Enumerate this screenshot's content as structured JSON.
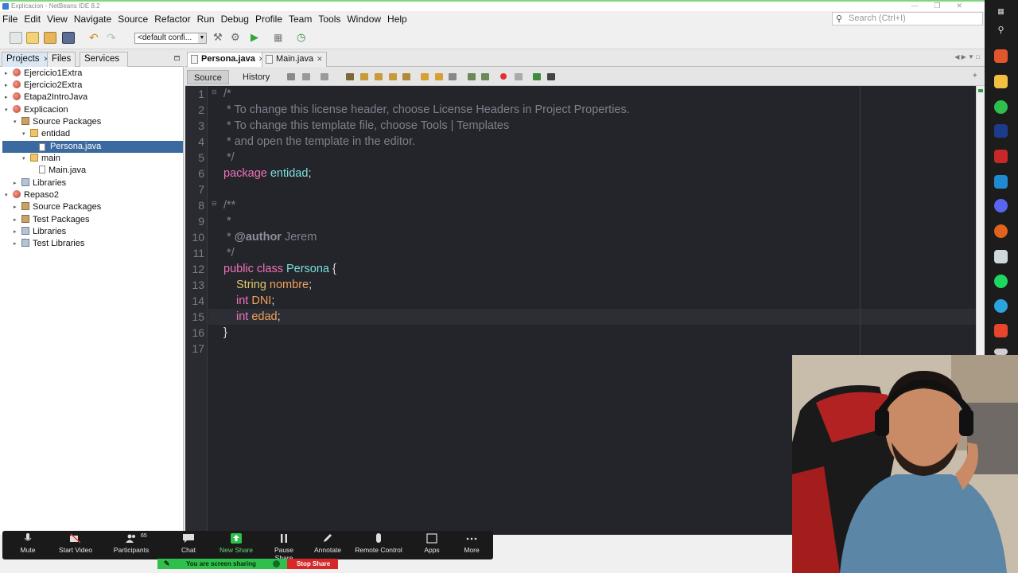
{
  "window": {
    "title": "Explicacion - NetBeans IDE 8.2",
    "controls": [
      "—",
      "❐",
      "✕"
    ]
  },
  "menu": [
    "File",
    "Edit",
    "View",
    "Navigate",
    "Source",
    "Refactor",
    "Run",
    "Debug",
    "Profile",
    "Team",
    "Tools",
    "Window",
    "Help"
  ],
  "search": {
    "placeholder": "Search (Ctrl+I)"
  },
  "toolbar": {
    "config": "<default confi..."
  },
  "left_panel": {
    "tabs": [
      "Projects",
      "Files",
      "Services"
    ],
    "tree": [
      {
        "label": "Ejercicio1Extra",
        "icon": "project-icon"
      },
      {
        "label": "Ejercicio2Extra",
        "icon": "project-icon"
      },
      {
        "label": "Etapa2IntroJava",
        "icon": "project-icon"
      },
      {
        "label": "Explicacion",
        "icon": "project-icon"
      },
      {
        "label": "Source Packages",
        "icon": "source-packages-icon"
      },
      {
        "label": "entidad",
        "icon": "package-icon"
      },
      {
        "label": "Persona.java",
        "icon": "java-file-icon",
        "selected": true
      },
      {
        "label": "main",
        "icon": "package-icon"
      },
      {
        "label": "Main.java",
        "icon": "java-file-icon"
      },
      {
        "label": "Libraries",
        "icon": "libraries-icon"
      },
      {
        "label": "Repaso2",
        "icon": "project-icon"
      },
      {
        "label": "Source Packages",
        "icon": "source-packages-icon"
      },
      {
        "label": "Test Packages",
        "icon": "test-packages-icon"
      },
      {
        "label": "Libraries",
        "icon": "libraries-icon"
      },
      {
        "label": "Test Libraries",
        "icon": "libraries-icon"
      }
    ]
  },
  "editor": {
    "tabs": [
      {
        "label": "Persona.java",
        "active": true
      },
      {
        "label": "Main.java",
        "active": false
      }
    ],
    "views": [
      "Source",
      "History"
    ],
    "line_numbers": [
      "1",
      "2",
      "3",
      "4",
      "5",
      "6",
      "7",
      "8",
      "9",
      "10",
      "11",
      "12",
      "13",
      "14",
      "15",
      "16",
      "17"
    ],
    "lines": {
      "l1": "/*",
      "l2": " * To change this license header, choose License Headers in Project Properties.",
      "l3": " * To change this template file, choose Tools | Templates",
      "l4": " * and open the template in the editor.",
      "l5": " */",
      "l6_kw": "package",
      "l6_name": "entidad",
      "l6_end": ";",
      "l8": "/**",
      "l9": " *",
      "l10_pre": " * ",
      "l10_tag": "@author",
      "l10_name": " Jerem",
      "l11": " */",
      "l12_kw": "public class",
      "l12_cls": "Persona",
      "l12_brace": " {",
      "l13_type": "String",
      "l13_fld": "nombre",
      "l14_type": "int",
      "l14_fld": "DNI",
      "l15_type": "int",
      "l15_fld": "edad",
      "semicolon": ";",
      "l16": "}"
    }
  },
  "zoom": {
    "buttons": [
      {
        "label": "Mute",
        "icon": "microphone-icon"
      },
      {
        "label": "Start Video",
        "icon": "video-off-icon"
      },
      {
        "label": "Participants",
        "icon": "participants-icon",
        "count": "65"
      },
      {
        "label": "Chat",
        "icon": "chat-icon"
      },
      {
        "label": "New Share",
        "icon": "share-icon"
      },
      {
        "label": "Pause Share",
        "icon": "pause-icon"
      },
      {
        "label": "Annotate",
        "icon": "pencil-icon"
      },
      {
        "label": "Remote Control",
        "icon": "mouse-icon"
      },
      {
        "label": "Apps",
        "icon": "apps-icon"
      },
      {
        "label": "More",
        "icon": "more-icon"
      }
    ],
    "sharing_text": "You are screen sharing",
    "stop_label": "Stop Share"
  },
  "colors": {
    "editor_bg": "#24252b",
    "keyword": "#ee72b8",
    "type": "#e3c76c",
    "class": "#7be0de",
    "field": "#f2a05a",
    "comment": "#7d808c",
    "selection": "#3b6aa0",
    "share_green": "#2fbf4c",
    "stop_red": "#d62828"
  }
}
